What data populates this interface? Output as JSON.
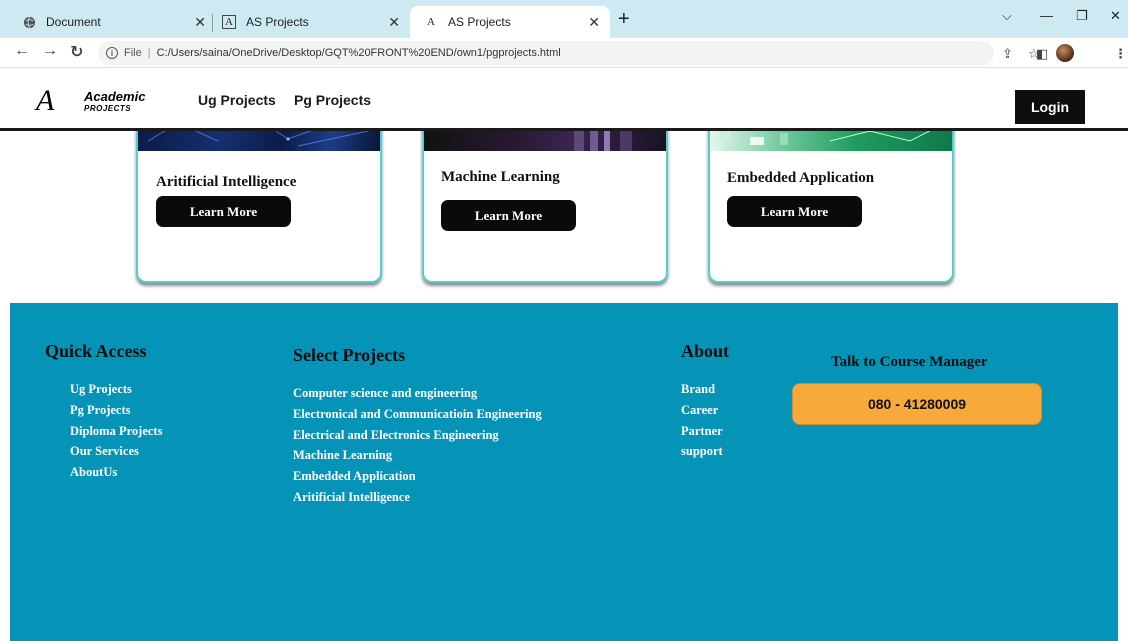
{
  "browser": {
    "tabs": [
      {
        "title": "Document",
        "icon": "globe-icon"
      },
      {
        "title": "AS Projects",
        "icon": "site-logo-icon"
      },
      {
        "title": "AS Projects",
        "icon": "site-logo-icon"
      }
    ],
    "address": {
      "scheme_label": "File",
      "separator": "|",
      "url": "C:/Users/saina/OneDrive/Desktop/GQT%20FRONT%20END/own1/pgprojects.html"
    }
  },
  "header": {
    "logo": {
      "mark": "A",
      "line1": "Academic",
      "line2": "PROJECTS"
    },
    "nav": [
      "Ug Projects",
      "Pg Projects"
    ],
    "login_label": "Login"
  },
  "cards": [
    {
      "title": "Aritificial Intelligence",
      "button": "Learn More"
    },
    {
      "title": "Machine Learning",
      "button": "Learn More"
    },
    {
      "title": "Embedded Application",
      "button": "Learn More"
    }
  ],
  "footer": {
    "quick_access": {
      "heading": "Quick Access",
      "items": [
        "Ug Projects",
        "Pg Projects",
        "Diploma Projects",
        "Our Services",
        "AboutUs"
      ]
    },
    "select_projects": {
      "heading": "Select Projects",
      "items": [
        "Computer science and engineering",
        "Electronical and Communicatioin Engineering",
        "Electrical and Electronics Engineering",
        "Machine Learning",
        "Embedded Application",
        "Aritificial Intelligence"
      ]
    },
    "about": {
      "heading": "About",
      "items": [
        "Brand",
        "Career",
        "Partner",
        "support"
      ]
    },
    "contact": {
      "heading": "Talk to Course Manager",
      "phone": "080 - 41280009"
    }
  },
  "colors": {
    "footer_bg": "#0593b7",
    "card_border": "#4fcfcf",
    "phone_button": "#f8a93b",
    "tabstrip": "#cdeaf3"
  }
}
